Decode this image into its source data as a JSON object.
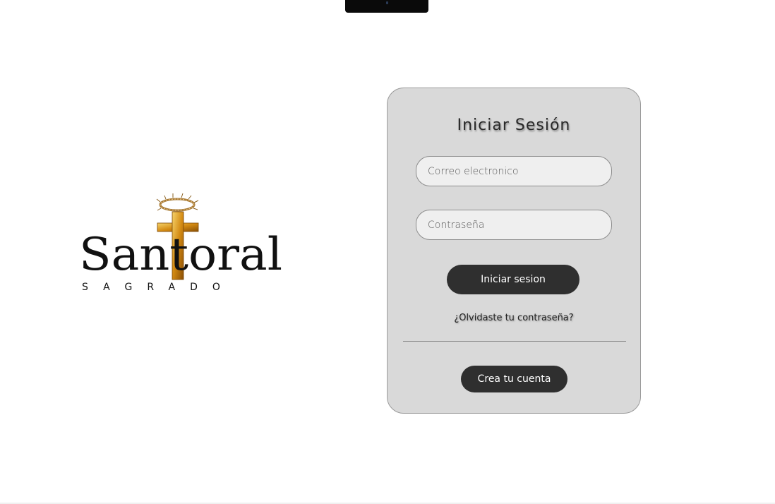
{
  "logo": {
    "wordmark": "Santoral",
    "tagline": "SAGRADO"
  },
  "login": {
    "title": "Iniciar Sesión",
    "email_placeholder": "Correo electronico",
    "password_placeholder": "Contraseña",
    "submit_label": "Iniciar sesion",
    "forgot_label": "¿Olvidaste tu contraseña?",
    "create_account_label": "Crea tu cuenta"
  },
  "colors": {
    "card_background": "#d9d9d9",
    "button_background": "#2f2f2f",
    "cross_gold": "#d89a1c",
    "text_dark": "#111111"
  }
}
